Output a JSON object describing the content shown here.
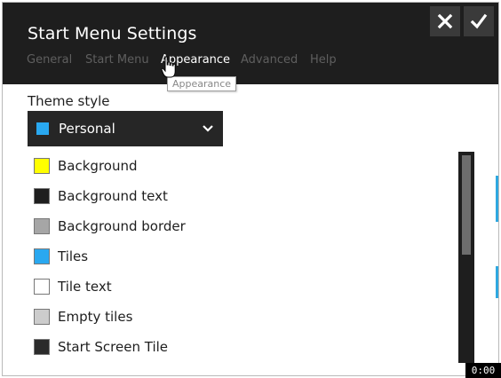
{
  "window": {
    "title": "Start Menu Settings"
  },
  "tabs": [
    {
      "label": "General"
    },
    {
      "label": "Start Menu"
    },
    {
      "label": "Appearance"
    },
    {
      "label": "Advanced"
    },
    {
      "label": "Help"
    }
  ],
  "active_tab": "Appearance",
  "tooltip": "Appearance",
  "buttons": {
    "close_icon": "close-icon",
    "ok_icon": "checkmark-icon"
  },
  "theme": {
    "label": "Theme style",
    "selected": "Personal",
    "selected_color": "#29a8f0"
  },
  "colors": [
    {
      "label": "Background",
      "color": "#ffff00"
    },
    {
      "label": "Background text",
      "color": "#1e1e1e"
    },
    {
      "label": "Background border",
      "color": "#a6a6a6"
    },
    {
      "label": "Tiles",
      "color": "#29a8f0"
    },
    {
      "label": "Tile text",
      "color": "#ffffff"
    },
    {
      "label": "Empty tiles",
      "color": "#cccccc"
    },
    {
      "label": "Start Screen Tile",
      "color": "#2b2b2b"
    }
  ],
  "timer": "0:00",
  "accent": "#29a8f0"
}
